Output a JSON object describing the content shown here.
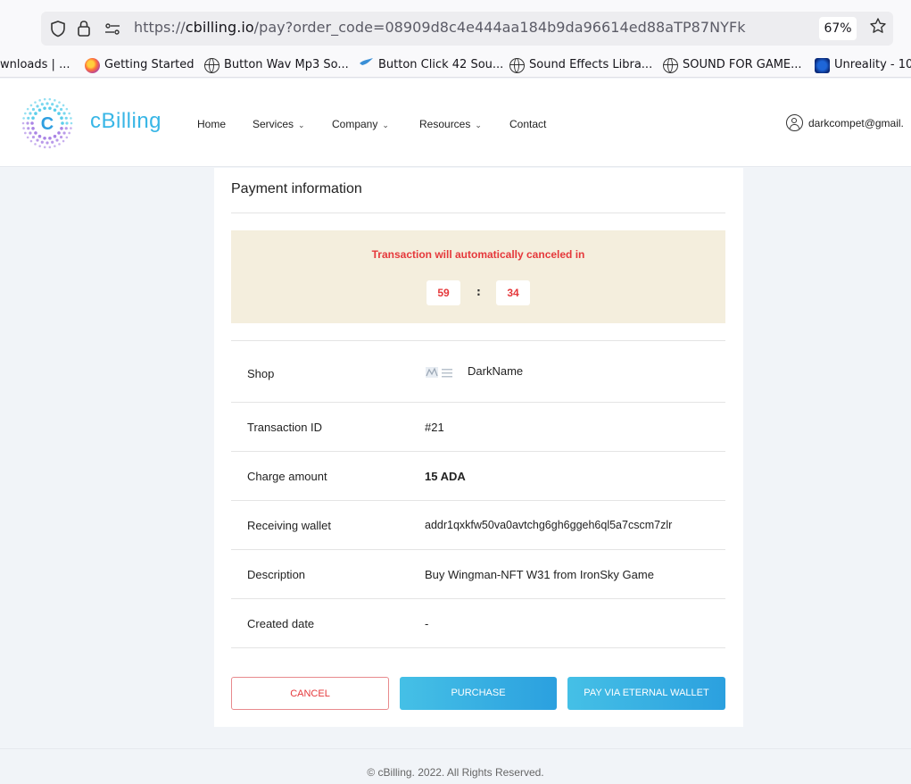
{
  "browser": {
    "url_prefix": "https://",
    "url_domain": "cbilling.io",
    "url_path": "/pay?order_code=08909d8c4e444aa184b9da96614ed88aTP87NYFk",
    "zoom": "67%",
    "bookmarks": [
      {
        "label": "wnloads | ...",
        "icon": "none"
      },
      {
        "label": "Getting Started",
        "icon": "firefox-icon"
      },
      {
        "label": "Button Wav Mp3 So...",
        "icon": "globe-icon"
      },
      {
        "label": "Button Click 42 Sou...",
        "icon": "bird-icon"
      },
      {
        "label": "Sound Effects Libra...",
        "icon": "globe-icon"
      },
      {
        "label": "SOUND FOR GAME...",
        "icon": "globe-icon"
      },
      {
        "label": "Unreality - 10",
        "icon": "blue-square-icon"
      }
    ]
  },
  "header": {
    "logo_letter": "C",
    "logo_text": "cBilling",
    "nav": [
      {
        "label": "Home",
        "dropdown": false
      },
      {
        "label": "Services",
        "dropdown": true
      },
      {
        "label": "Company",
        "dropdown": true
      },
      {
        "label": "Resources",
        "dropdown": true
      },
      {
        "label": "Contact",
        "dropdown": false
      }
    ],
    "user_email": "darkcompet@gmail."
  },
  "payment": {
    "title": "Payment information",
    "timer_message": "Transaction will automatically canceled in",
    "timer_minutes": "59",
    "timer_separator": ":",
    "timer_seconds": "34",
    "rows": [
      {
        "label": "Shop",
        "value": "DarkName"
      },
      {
        "label": "Transaction ID",
        "value": "#21"
      },
      {
        "label": "Charge amount",
        "value": "15 ADA"
      },
      {
        "label": "Receiving wallet",
        "value": "addr1qxkfw50va0avtchg6gh6ggeh6ql5a7cscm7zlr"
      },
      {
        "label": "Description",
        "value": "Buy Wingman-NFT W31 from IronSky Game"
      },
      {
        "label": "Created date",
        "value": "-"
      }
    ],
    "buttons": {
      "cancel": "CANCEL",
      "purchase": "PURCHASE",
      "eternal": "PAY VIA ETERNAL WALLET"
    }
  },
  "footer": {
    "text": "© cBilling. 2022. All Rights Reserved."
  },
  "colors": {
    "brand": "#38b6e6",
    "danger": "#e5383b",
    "timer_bg": "#f4eedd"
  }
}
